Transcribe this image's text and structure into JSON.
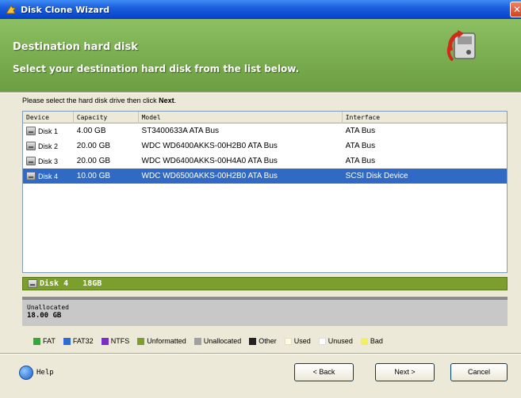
{
  "window": {
    "title": "Disk Clone Wizard",
    "close_glyph": "✕"
  },
  "header": {
    "title": "Destination hard disk",
    "subtitle": "Select your destination hard disk from the list below.",
    "icon": "disk-clone-icon"
  },
  "instruction": {
    "prefix": "Please select the hard disk drive then click ",
    "bold": "Next",
    "suffix": "."
  },
  "table": {
    "columns": [
      "Device",
      "Capacity",
      "Model",
      "Interface"
    ],
    "rows": [
      {
        "device": "Disk 1",
        "capacity": "4.00 GB",
        "model": "ST3400633A ATA Bus",
        "interface": "ATA Bus",
        "selected": false
      },
      {
        "device": "Disk 2",
        "capacity": "20.00 GB",
        "model": "WDC WD6400AKKS-00H2B0 ATA Bus",
        "interface": "ATA Bus",
        "selected": false
      },
      {
        "device": "Disk 3",
        "capacity": "20.00 GB",
        "model": "WDC WD6400AKKS-00H4A0 ATA Bus",
        "interface": "ATA Bus",
        "selected": false
      },
      {
        "device": "Disk 4",
        "capacity": "10.00 GB",
        "model": "WDC WD6500AKKS-00H2B0 ATA Bus",
        "interface": "SCSI Disk Device",
        "selected": true
      }
    ]
  },
  "disk_bar": {
    "label": "Disk 4   18GB",
    "color": "#7c9e2c"
  },
  "partition": {
    "label": "Unallocated",
    "size": "18.00 GB",
    "color": "#c8c8c8"
  },
  "legend": [
    {
      "label": "FAT",
      "color": "#3aa33a"
    },
    {
      "label": "FAT32",
      "color": "#2a6bd6"
    },
    {
      "label": "NTFS",
      "color": "#7b2cc9"
    },
    {
      "label": "Unformatted",
      "color": "#7c9e2c"
    },
    {
      "label": "Unallocated",
      "color": "#a0a0a0"
    },
    {
      "label": "Other",
      "color": "#222222"
    },
    {
      "label": "Used",
      "color": "#fffbe0"
    },
    {
      "label": "Unused",
      "color": "#ffffff"
    },
    {
      "label": "Bad",
      "color": "#f3f060"
    }
  ],
  "footer": {
    "help": "Help",
    "back": "< Back",
    "next": "Next >",
    "cancel": "Cancel"
  }
}
